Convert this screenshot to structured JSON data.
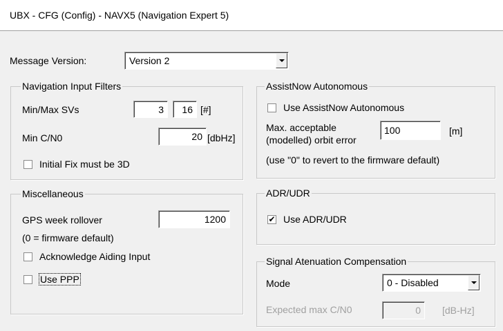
{
  "title": "UBX - CFG (Config) - NAVX5 (Navigation Expert 5)",
  "message_version": {
    "label": "Message Version:",
    "value": "Version 2"
  },
  "nav_filters": {
    "legend": "Navigation Input Filters",
    "minmax_label": "Min/Max SVs",
    "min_svs": "3",
    "max_svs": "16",
    "svs_unit": "[#]",
    "mincno_label": "Min C/N0",
    "mincno_value": "20",
    "mincno_unit": "[dbHz]",
    "initial_fix_label": "Initial Fix must be 3D",
    "initial_fix_checked": false
  },
  "misc": {
    "legend": "Miscellaneous",
    "week_rollover_label": "GPS week rollover",
    "week_rollover_value": "1200",
    "week_rollover_note": "(0 = firmware default)",
    "ack_aiding_label": "Acknowledge Aiding Input",
    "ack_aiding_checked": false,
    "use_ppp_label": "Use PPP",
    "use_ppp_checked": false
  },
  "assistnow": {
    "legend": "AssistNow Autonomous",
    "use_label": "Use AssistNow Autonomous",
    "use_checked": false,
    "orbit_label_line1": "Max. acceptable",
    "orbit_label_line2": "(modelled) orbit error",
    "orbit_value": "100",
    "orbit_unit": "[m]",
    "note": "(use \"0\" to revert to the firmware default)"
  },
  "adr": {
    "legend": "ADR/UDR",
    "use_label": "Use ADR/UDR",
    "use_checked": true,
    "check_glyph": "✔"
  },
  "signal_atten": {
    "legend": "Signal Atenuation Compensation",
    "mode_label": "Mode",
    "mode_value": "0 - Disabled",
    "expected_label": "Expected max C/N0",
    "expected_value": "0",
    "expected_unit": "[dB-Hz]"
  },
  "colors": {
    "window_bg": "#f0f0f0",
    "title_bg": "#ffffff",
    "disabled_text": "#a0a0a0"
  }
}
